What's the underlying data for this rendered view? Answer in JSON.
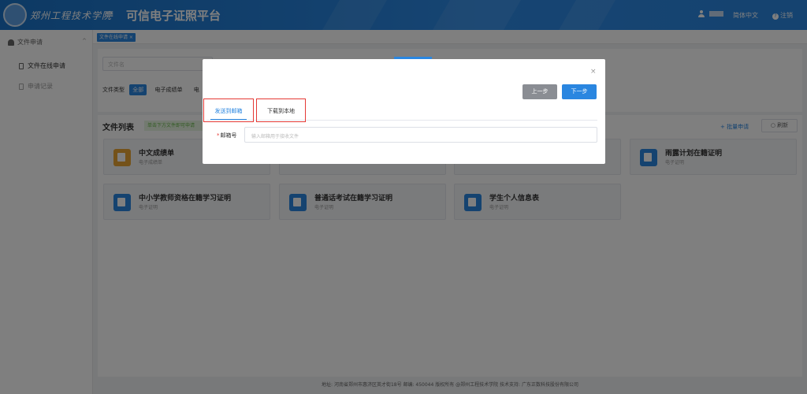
{
  "header": {
    "logo_text": "郑州工程技术学院",
    "menu_glyph": "≡",
    "platform_title": "可信电子证照平台",
    "language": "简体中文",
    "logout": "注销",
    "logout_glyph": "?"
  },
  "sidebar": {
    "group_label": "文件申请",
    "group_arrow": "^",
    "items": [
      {
        "label": "文件在线申请"
      },
      {
        "label": "申请记录"
      }
    ]
  },
  "tabbar": {
    "active_tab": "文件在线申请 ×"
  },
  "filter": {
    "search_placeholder": "文件名",
    "type_label": "文件类型",
    "types": [
      "全部",
      "电子成绩单",
      "电"
    ]
  },
  "file_list": {
    "title": "文件列表",
    "hint": "单击下方文件即可申请",
    "batch_apply": "+ 批量申请",
    "refresh": "○ 刷新",
    "cards": [
      {
        "title": "中文成绩单",
        "subtitle": "电子成绩单"
      },
      {
        "title": "雨露计划在籍证明",
        "subtitle": "电子证明"
      },
      {
        "title": "中小学教师资格在籍学习证明",
        "subtitle": "电子证明"
      },
      {
        "title": "普通话考试在籍学习证明",
        "subtitle": "电子证明"
      },
      {
        "title": "学生个人信息表",
        "subtitle": "电子证明"
      }
    ]
  },
  "dialog": {
    "close": "×",
    "prev_button": "上一步",
    "next_button": "下一步",
    "tabs": [
      "发送到邮箱",
      "下载到本地"
    ],
    "email_required_mark": "*",
    "email_label": "邮箱号",
    "email_placeholder": "输入邮箱用于接收文件"
  },
  "footer": {
    "text": "地址: 河南省郑州市惠济区英才街18号   邮编: 450044   版权所有 @郑州工程技术学院   技术支持: 广东正数科技股份有限公司"
  },
  "colors": {
    "primary": "#2a86e0",
    "highlight_border": "#e53935",
    "gray_button": "#8a8d93"
  }
}
